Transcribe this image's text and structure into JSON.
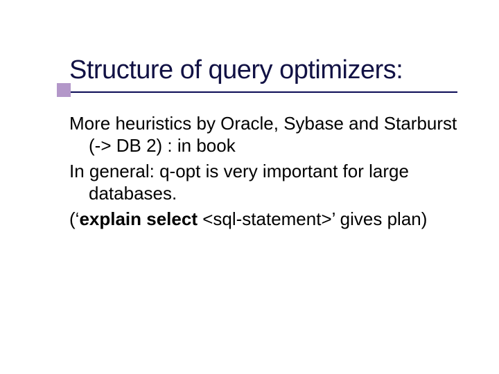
{
  "slide": {
    "title": "Structure of query optimizers:",
    "paragraphs": {
      "p1": "More heuristics by Oracle, Sybase and Starburst (-> DB 2) : in book",
      "p2": "In general: q-opt is very important for large databases.",
      "p3_pre": "(‘",
      "p3_bold": "explain select",
      "p3_post": " <sql-statement>’ gives plan)"
    }
  }
}
